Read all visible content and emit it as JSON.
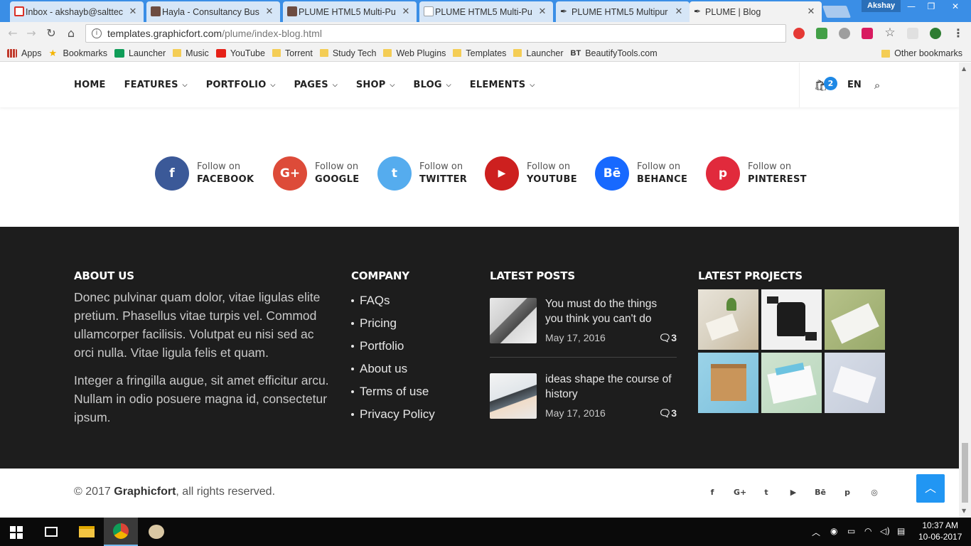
{
  "browser": {
    "tabs": [
      {
        "title": "Inbox - akshayb@salttec",
        "favicon": "gmail-icon",
        "color": "#d93025"
      },
      {
        "title": "Hayla - Consultancy Bus",
        "favicon": "page-icon",
        "color": "#6d4c41"
      },
      {
        "title": "PLUME HTML5 Multi-Pu",
        "favicon": "page-icon",
        "color": "#6d4c41"
      },
      {
        "title": "PLUME HTML5 Multi-Pu",
        "favicon": "document-icon",
        "color": "#9aa0a6"
      },
      {
        "title": "PLUME HTML5 Multipur",
        "favicon": "feather-icon",
        "color": "#333333"
      },
      {
        "title": "PLUME | Blog",
        "favicon": "feather-icon",
        "color": "#333333"
      }
    ],
    "profile": "Akshay",
    "url_domain": "templates.graphicfort.com",
    "url_path": "/plume/index-blog.html",
    "bookmarks": [
      {
        "label": "Apps",
        "icon": "apps-icon"
      },
      {
        "label": "Bookmarks",
        "icon": "star-icon"
      },
      {
        "label": "Launcher",
        "icon": "sheets-icon"
      },
      {
        "label": "Music",
        "icon": "folder-icon"
      },
      {
        "label": "YouTube",
        "icon": "youtube-icon"
      },
      {
        "label": "Torrent",
        "icon": "folder-icon"
      },
      {
        "label": "Study Tech",
        "icon": "folder-icon"
      },
      {
        "label": "Web Plugins",
        "icon": "folder-icon"
      },
      {
        "label": "Templates",
        "icon": "folder-icon"
      },
      {
        "label": "Launcher",
        "icon": "folder-icon"
      },
      {
        "label": "BeautifyTools.com",
        "icon": "bt-icon"
      }
    ],
    "other_bookmarks": "Other bookmarks"
  },
  "nav": {
    "items": [
      {
        "label": "HOME",
        "dropdown": false
      },
      {
        "label": "FEATURES",
        "dropdown": true
      },
      {
        "label": "PORTFOLIO",
        "dropdown": true
      },
      {
        "label": "PAGES",
        "dropdown": true
      },
      {
        "label": "SHOP",
        "dropdown": true
      },
      {
        "label": "BLOG",
        "dropdown": true
      },
      {
        "label": "ELEMENTS",
        "dropdown": true
      }
    ],
    "cart_count": "2",
    "language": "EN"
  },
  "social": [
    {
      "small": "Follow on",
      "big": "FACEBOOK",
      "glyph": "f",
      "icon": "facebook-icon",
      "color": "#3b5998"
    },
    {
      "small": "Follow on",
      "big": "GOOGLE",
      "glyph": "G+",
      "icon": "google-plus-icon",
      "color": "#dd4b39"
    },
    {
      "small": "Follow on",
      "big": "TWITTER",
      "glyph": "t",
      "icon": "twitter-icon",
      "color": "#55acee"
    },
    {
      "small": "Follow on",
      "big": "YOUTUBE",
      "glyph": "▶",
      "icon": "youtube-icon",
      "color": "#cd201f"
    },
    {
      "small": "Follow on",
      "big": "BEHANCE",
      "glyph": "Bē",
      "icon": "behance-icon",
      "color": "#1769ff"
    },
    {
      "small": "Follow on",
      "big": "PINTEREST",
      "glyph": "p",
      "icon": "pinterest-icon",
      "color": "#e12a3c"
    }
  ],
  "footer": {
    "about": {
      "heading": "ABOUT US",
      "p1": "Donec pulvinar quam dolor, vitae ligulas elite pretium. Phasellus vitae turpis vel. Commod ullamcorper facilisis. Volutpat eu nisi sed ac orci nulla. Vitae ligula felis et quam.",
      "p2": "Integer a fringilla augue, sit amet efficitur arcu. Nullam in odio posuere magna id, consectetur ipsum."
    },
    "company": {
      "heading": "COMPANY",
      "links": [
        "FAQs",
        "Pricing",
        "Portfolio",
        "About us",
        "Terms of use",
        "Privacy Policy"
      ]
    },
    "posts": {
      "heading": "LATEST POSTS",
      "items": [
        {
          "title": "You must do the things you think you can't do",
          "date": "May 17, 2016",
          "comments": "3"
        },
        {
          "title": "ideas shape the course of history",
          "date": "May 17, 2016",
          "comments": "3"
        }
      ]
    },
    "projects": {
      "heading": "LATEST PROJECTS"
    }
  },
  "bottom": {
    "copy_prefix": "© 2017 ",
    "brand": "Graphicfort",
    "copy_suffix": ", all rights reserved.",
    "social_glyphs": [
      "f",
      "G+",
      "t",
      "▶",
      "Bē",
      "p",
      "◎"
    ]
  },
  "taskbar": {
    "time": "10:37 AM",
    "date": "10-06-2017"
  }
}
